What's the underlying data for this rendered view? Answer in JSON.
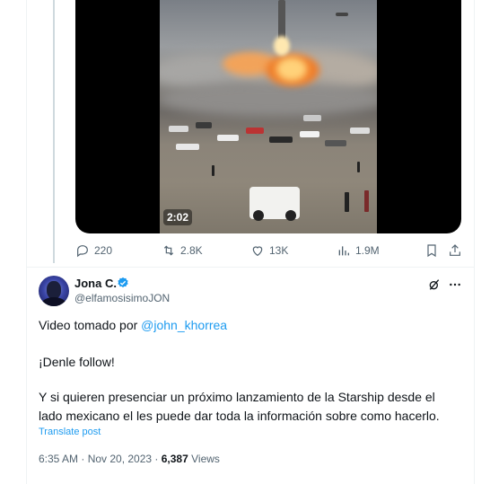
{
  "video": {
    "duration": "2:02"
  },
  "actions": {
    "replies": "220",
    "reposts": "2.8K",
    "likes": "13K",
    "views": "1.9M"
  },
  "tweet": {
    "display_name": "Jona C.",
    "handle": "@elfamosisimoJON",
    "line1_prefix": "Video tomado por ",
    "mention": "@john_khorrea",
    "line2": "¡Denle follow!",
    "line3": "Y si quieren presenciar un próximo lanzamiento de la Starship desde el",
    "line4": "lado mexicano el les puede dar toda la información sobre como hacerlo.",
    "translate": "Translate post",
    "time": "6:35 AM · Nov 20, 2023 · ",
    "views_count": "6,387",
    "views_label": " Views"
  },
  "colors": {
    "accent": "#1d9bf0",
    "muted": "#536471",
    "text": "#0f1419"
  },
  "icons": [
    "reply-icon",
    "repost-icon",
    "like-icon",
    "views-icon",
    "bookmark-icon",
    "share-icon",
    "verified-badge-icon",
    "grok-icon",
    "more-icon"
  ]
}
